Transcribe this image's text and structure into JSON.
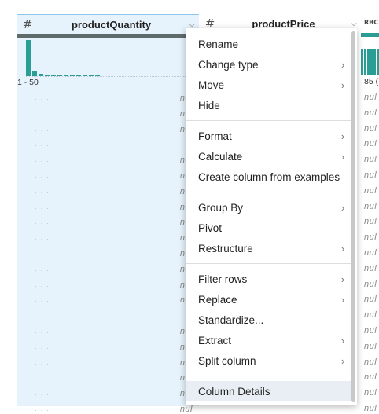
{
  "columns": {
    "quantity": {
      "icon": "hash-icon",
      "title": "productQuantity",
      "range_label": "1 - 50",
      "histogram": [
        1,
        0.16,
        0.06,
        0.04,
        0.03,
        0.03,
        0.02,
        0.04,
        0.02,
        0.02,
        0.03,
        0.02
      ]
    },
    "price": {
      "icon": "hash-icon",
      "title": "productPrice"
    },
    "third": {
      "type_label": "RBC",
      "range_label": "85 ("
    }
  },
  "cells": {
    "null_text": "nul",
    "rows": [
      true,
      true,
      true,
      false,
      true,
      true,
      true,
      true,
      true,
      true,
      true,
      true,
      true,
      true,
      false,
      true,
      true,
      true,
      true,
      true,
      true
    ]
  },
  "menu": {
    "groups": [
      [
        {
          "label": "Rename",
          "submenu": false
        },
        {
          "label": "Change type",
          "submenu": true
        },
        {
          "label": "Move",
          "submenu": true
        },
        {
          "label": "Hide",
          "submenu": false
        }
      ],
      [
        {
          "label": "Format",
          "submenu": true
        },
        {
          "label": "Calculate",
          "submenu": true
        },
        {
          "label": "Create column from examples",
          "submenu": false
        }
      ],
      [
        {
          "label": "Group By",
          "submenu": true
        },
        {
          "label": "Pivot",
          "submenu": false
        },
        {
          "label": "Restructure",
          "submenu": true
        }
      ],
      [
        {
          "label": "Filter rows",
          "submenu": true
        },
        {
          "label": "Replace",
          "submenu": true
        },
        {
          "label": "Standardize...",
          "submenu": false
        },
        {
          "label": "Extract",
          "submenu": true
        },
        {
          "label": "Split column",
          "submenu": true
        }
      ],
      [
        {
          "label": "Column Details",
          "submenu": false,
          "highlighted": true
        }
      ]
    ]
  }
}
